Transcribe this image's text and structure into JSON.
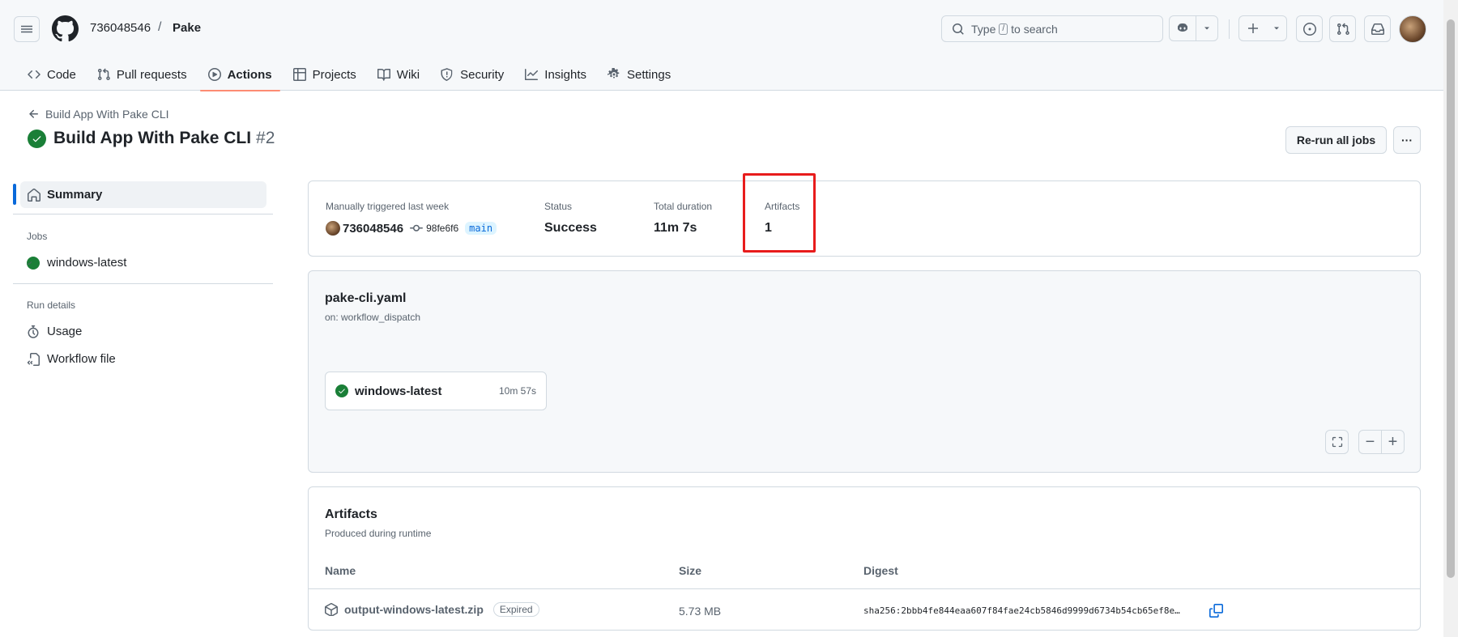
{
  "header": {
    "owner": "736048546",
    "separator": "/",
    "repo": "Pake",
    "search": {
      "prefix": "Type",
      "key": "/",
      "suffix": "to search"
    }
  },
  "tabs": [
    {
      "label": "Code",
      "icon": "code-icon"
    },
    {
      "label": "Pull requests",
      "icon": "git-pull-request-icon"
    },
    {
      "label": "Actions",
      "icon": "play-icon",
      "active": true
    },
    {
      "label": "Projects",
      "icon": "table-icon"
    },
    {
      "label": "Wiki",
      "icon": "book-icon"
    },
    {
      "label": "Security",
      "icon": "shield-icon"
    },
    {
      "label": "Insights",
      "icon": "graph-icon"
    },
    {
      "label": "Settings",
      "icon": "gear-icon"
    }
  ],
  "run": {
    "back_label": "Build App With Pake CLI",
    "title": "Build App With Pake CLI",
    "number": "#2",
    "rerun_label": "Re-run all jobs",
    "more_label": "···"
  },
  "sidebar": {
    "summary_label": "Summary",
    "jobs_heading": "Jobs",
    "job_label": "windows-latest",
    "run_details_heading": "Run details",
    "usage_label": "Usage",
    "workflow_file_label": "Workflow file"
  },
  "summary": {
    "trigger_label": "Manually triggered last week",
    "actor": "736048546",
    "commit": "98fe6f6",
    "branch": "main",
    "status_label": "Status",
    "status_value": "Success",
    "duration_label": "Total duration",
    "duration_value": "11m 7s",
    "artifacts_label": "Artifacts",
    "artifacts_value": "1"
  },
  "workflow": {
    "file": "pake-cli.yaml",
    "trigger": "on: workflow_dispatch",
    "job_name": "windows-latest",
    "job_time": "10m 57s",
    "zoom_out": "−",
    "zoom_in": "+"
  },
  "artifacts": {
    "title": "Artifacts",
    "subtitle": "Produced during runtime",
    "columns": [
      "Name",
      "Size",
      "Digest"
    ],
    "row": {
      "name": "output-windows-latest.zip",
      "badge": "Expired",
      "size": "5.73 MB",
      "digest": "sha256:2bbb4fe844eaa607f84fae24cb5846d9999d6734b54cb65ef8e…"
    }
  },
  "colors": {
    "accent": "#0969da",
    "success": "#1a7f37",
    "tab_underline": "#fd8c73",
    "highlight": "#e81c1c"
  }
}
